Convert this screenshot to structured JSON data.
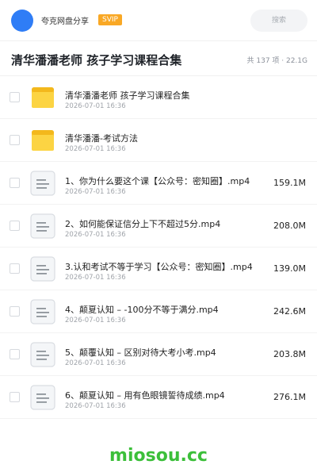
{
  "header": {
    "sharer_name": "夸克网盘分享",
    "badge": "SVIP",
    "search_placeholder": "搜索",
    "accent_color": "#2f7df6",
    "badge_color": "#f9a825"
  },
  "title_row": {
    "title": "清华潘潘老师 孩子学习课程合集",
    "summary": "共 137 项 · 22.1G"
  },
  "files": [
    {
      "type": "folder",
      "icon": "folder-icon",
      "name": "清华潘潘老师 孩子学习课程合集",
      "date": "2026-07-01 16:36",
      "size": ""
    },
    {
      "type": "folder",
      "icon": "folder-icon",
      "name": "清华潘潘-考试方法",
      "date": "2026-07-01 16:36",
      "size": ""
    },
    {
      "type": "file",
      "icon": "document-icon",
      "name": "1、你为什么要这个课【公众号：密知圈】.mp4",
      "date": "2026-07-01 16:36",
      "size": "159.1M"
    },
    {
      "type": "file",
      "icon": "document-icon",
      "name": "2、如何能保证信分上下不超过5分.mp4",
      "date": "2026-07-01 16:36",
      "size": "208.0M"
    },
    {
      "type": "file",
      "icon": "document-icon",
      "name": "3.认和考试不等于学习【公众号：密知圈】.mp4",
      "date": "2026-07-01 16:36",
      "size": "139.0M"
    },
    {
      "type": "file",
      "icon": "document-icon",
      "name": "4、颠夏认知 – -100分不等于满分.mp4",
      "date": "2026-07-01 16:36",
      "size": "242.6M"
    },
    {
      "type": "file",
      "icon": "document-icon",
      "name": "5、颠覆认知 – 区别对待大考小考.mp4",
      "date": "2026-07-01 16:36",
      "size": "203.8M"
    },
    {
      "type": "file",
      "icon": "document-icon",
      "name": "6、颠夏认知 – 用有色眼镜誓待成绩.mp4",
      "date": "2026-07-01 16:36",
      "size": "276.1M"
    }
  ],
  "watermark": "miosou.cc"
}
